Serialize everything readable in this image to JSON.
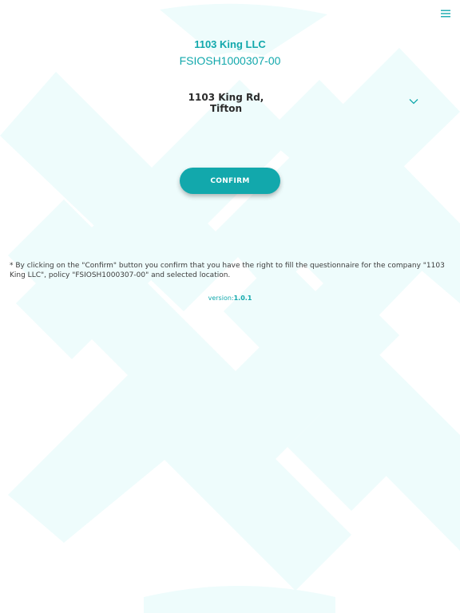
{
  "header": {
    "company_name": "1103 King LLC",
    "policy_number": "FSIOSH1000307-00"
  },
  "location": {
    "selected_line1": "1103 King Rd,",
    "selected_line2": "Tifton"
  },
  "confirm_button": {
    "label": "CONFIRM"
  },
  "disclaimer": {
    "text": "* By clicking on the \"Confirm\" button you confirm that you have the right to fill the questionnaire for the company \"1103 King LLC\", policy \"FSIOSH1000307-00\" and selected location."
  },
  "version": {
    "label": "version:",
    "number": "1.0.1"
  },
  "icons": {
    "menu": "hamburger-menu-icon",
    "dropdown": "chevron-down-icon"
  },
  "colors": {
    "accent": "#12a8ac",
    "background_pattern": "#eefcfc",
    "text": "#2b2b2b"
  }
}
